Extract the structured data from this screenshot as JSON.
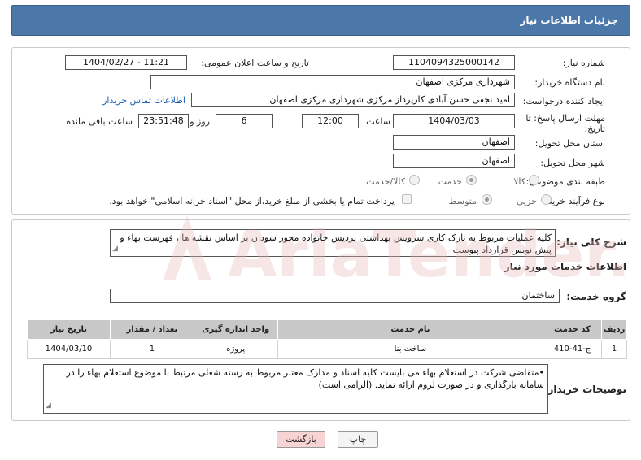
{
  "title": "جزئیات اطلاعات نیاز",
  "fields": {
    "need_number_label": "شماره نیاز:",
    "need_number": "1104094325000142",
    "announce_label": "تاریخ و ساعت اعلان عمومی:",
    "announce_value": "1404/02/27 - 11:21",
    "buyer_org_label": "نام دستگاه خریدار:",
    "buyer_org": "شهرداری مرکزی اصفهان",
    "creator_label": "ایجاد کننده درخواست:",
    "creator": "امید نجفی حسن آبادی کارپرداز مرکزی شهرداری مرکزی اصفهان",
    "contact_link": "اطلاعات تماس خریدار",
    "deadline_label": "مهلت ارسال پاسخ: تا تاریخ:",
    "deadline_date": "1404/03/03",
    "time_label": "ساعت",
    "deadline_time": "12:00",
    "days_value": "6",
    "days_label": "روز و",
    "remaining_value": "23:51:48",
    "remaining_label": "ساعت باقی مانده",
    "province_label": "استان محل تحویل:",
    "province": "اصفهان",
    "city_label": "شهر محل تحویل:",
    "city": "اصفهان",
    "category_label": "طبقه بندی موضوعی:",
    "category_options": [
      "کالا",
      "خدمت",
      "کالا/خدمت"
    ],
    "process_label": "نوع فرآیند خرید :",
    "process_options": [
      "جزیی",
      "متوسط"
    ],
    "payment_note": "پرداخت تمام یا بخشی از مبلغ خرید،از محل \"اسناد خزانه اسلامی\" خواهد بود."
  },
  "description": {
    "label": "شرح کلی نیاز:",
    "text": "کلیه عملیات مربوط به نازک کاری سرویس بهداشتی پردیس خانواده محور سودان بر اساس نقشه ها ، فهرست بهاء و پیش نویس قرارداد پیوست"
  },
  "services": {
    "section_title": "اطلاعات خدمات مورد نیاز",
    "group_label": "گروه خدمت:",
    "group_value": "ساختمان",
    "columns": [
      "ردیف",
      "کد خدمت",
      "نام خدمت",
      "واحد اندازه گیری",
      "تعداد / مقدار",
      "تاریخ نیاز"
    ],
    "rows": [
      [
        "1",
        "ج-41-410",
        "ساخت بنا",
        "پروژه",
        "1",
        "1404/03/10"
      ]
    ]
  },
  "buyer_notes": {
    "label": "توضیحات خریدار:",
    "text": "•متقاضی شرکت در استعلام بهاء می بایست کلیه اسناد و مدارک معتبر مربوط به رسته شغلی مرتبط با موضوع استعلام بهاء را در سامانه بارگذاری و در صورت لزوم ارائه نماید. (الزامی است)"
  },
  "buttons": {
    "print": "چاپ",
    "back": "بازگشت"
  },
  "watermark_text": "AriaTender.net",
  "colors": {
    "title_bg": "#4b78a8",
    "link": "#1a5fb4",
    "back_button_bg": "#f7d3d3",
    "watermark": "#e6b8b8"
  }
}
